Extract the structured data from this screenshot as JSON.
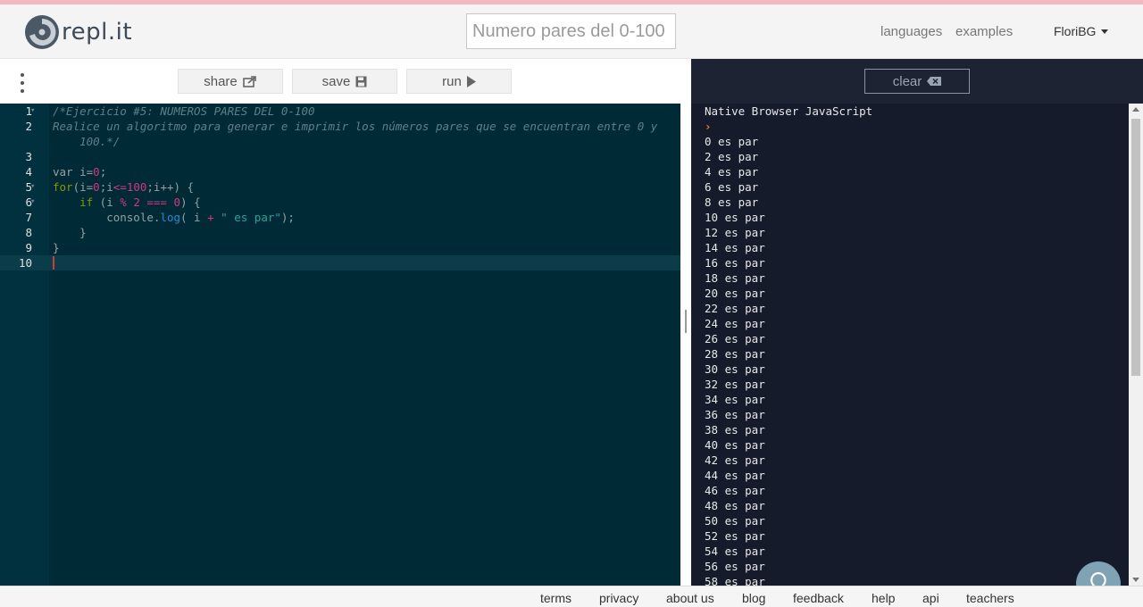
{
  "app": {
    "logo_text": "repl.it",
    "title_value": "Numero pares del 0-100"
  },
  "nav": {
    "languages": "languages",
    "examples": "examples",
    "user": "FloriBG"
  },
  "toolbar": {
    "share_label": "share",
    "save_label": "save",
    "run_label": "run"
  },
  "editor": {
    "lines": [
      {
        "n": "1"
      },
      {
        "n": "2"
      },
      {
        "n": "3"
      },
      {
        "n": "4"
      },
      {
        "n": "5"
      },
      {
        "n": "6"
      },
      {
        "n": "7"
      },
      {
        "n": "8"
      },
      {
        "n": "9"
      },
      {
        "n": "10"
      }
    ],
    "code": {
      "l1": "/*Ejercicio #5: NUMEROS PARES DEL 0-100",
      "l2a": "Realice un algoritmo para generar e imprimir los números pares que se encuentran entre 0 y",
      "l2b": "    100.*/",
      "l4_kw": "var",
      "l4_var": " i=",
      "l4_num": "0",
      "l4_end": ";",
      "l5_kw": "for",
      "l5_a": "(i=",
      "l5_n0": "0",
      "l5_b": ";i",
      "l5_op": "<=",
      "l5_n100": "100",
      "l5_c": ";i++) {",
      "l6_kw": "    if",
      "l6_a": " (i ",
      "l6_op": "%",
      "l6_sp": " ",
      "l6_n2": "2",
      "l6_eq": " === ",
      "l6_n0": "0",
      "l6_c": ") {",
      "l7_a": "        console.",
      "l7_fn": "log",
      "l7_b": "( i ",
      "l7_op": "+",
      "l7_sp": " ",
      "l7_str": "\" es par\"",
      "l7_c": ");",
      "l8": "    }",
      "l9": "}"
    }
  },
  "console": {
    "clear_label": "clear",
    "header": "Native Browser JavaScript",
    "prompt": "›",
    "output": [
      "0 es par",
      "2 es par",
      "4 es par",
      "6 es par",
      "8 es par",
      "10 es par",
      "12 es par",
      "14 es par",
      "16 es par",
      "18 es par",
      "20 es par",
      "22 es par",
      "24 es par",
      "26 es par",
      "28 es par",
      "30 es par",
      "32 es par",
      "34 es par",
      "36 es par",
      "38 es par",
      "40 es par",
      "42 es par",
      "44 es par",
      "46 es par",
      "48 es par",
      "50 es par",
      "52 es par",
      "54 es par",
      "56 es par",
      "58 es par"
    ]
  },
  "footer": {
    "terms": "terms",
    "privacy": "privacy",
    "about": "about us",
    "blog": "blog",
    "feedback": "feedback",
    "help": "help",
    "api": "api",
    "teachers": "teachers"
  },
  "colors": {
    "editor_bg": "#002b36",
    "console_bg": "#151b2b",
    "accent": "#d33682"
  }
}
